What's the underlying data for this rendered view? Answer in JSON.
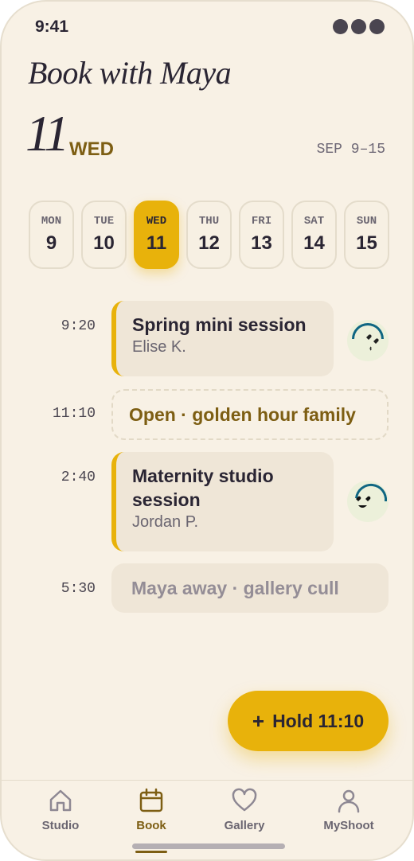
{
  "status": {
    "time": "9:41"
  },
  "header": {
    "title": "Book with Maya",
    "day_number": "11",
    "day_name": "WED",
    "week_range": "SEP 9–15"
  },
  "week": [
    {
      "name": "MON",
      "date": "9"
    },
    {
      "name": "TUE",
      "date": "10"
    },
    {
      "name": "WED",
      "date": "11",
      "selected": true
    },
    {
      "name": "THU",
      "date": "12"
    },
    {
      "name": "FRI",
      "date": "13"
    },
    {
      "name": "SAT",
      "date": "14"
    },
    {
      "name": "SUN",
      "date": "15"
    }
  ],
  "schedule": {
    "slot1": {
      "time": "9:20",
      "title": "Spring mini session",
      "client": "Elise K.",
      "avatar": "heart-kiss-face-icon"
    },
    "slot2": {
      "time": "11:10",
      "label": "Open · golden hour family"
    },
    "slot3": {
      "time": "2:40",
      "title": "Maternity studio session",
      "client": "Jordan P.",
      "avatar": "heart-eyes-face-icon"
    },
    "slot4": {
      "time": "5:30",
      "label": "Maya away · gallery cull"
    }
  },
  "fab": {
    "plus": "+",
    "label": "Hold 11:10"
  },
  "tabs": [
    {
      "label": "Studio",
      "icon": "home-icon"
    },
    {
      "label": "Book",
      "icon": "calendar-icon",
      "active": true
    },
    {
      "label": "Gallery",
      "icon": "heart-icon"
    },
    {
      "label": "MyShoot",
      "icon": "person-icon"
    }
  ],
  "colors": {
    "accent": "#e8b20b",
    "accent_text": "#7d5e13",
    "background": "#f8f1e5",
    "card": "#efe6d7",
    "ink": "#2a2533"
  }
}
